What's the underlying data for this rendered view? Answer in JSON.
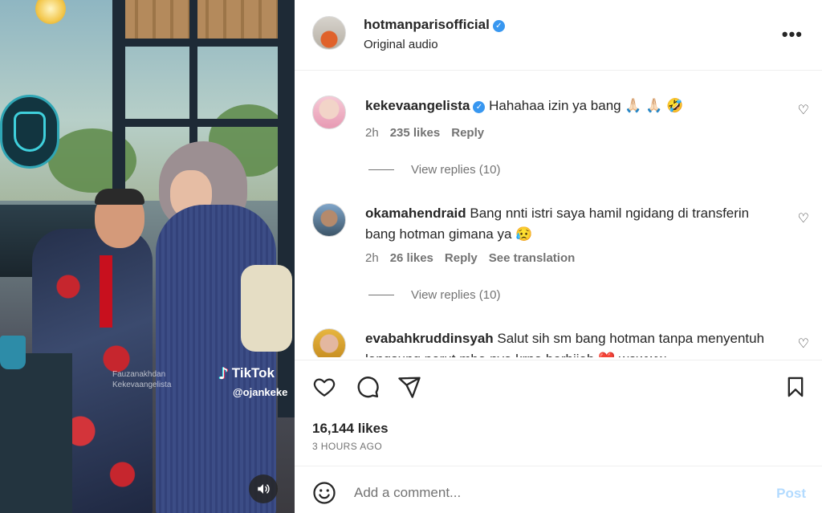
{
  "post": {
    "username": "hotmanparisofficial",
    "audio": "Original audio",
    "verified": true,
    "likes": "16,144 likes",
    "time": "3 HOURS AGO"
  },
  "media": {
    "watermark_line1": "Fauzanakhdan",
    "watermark_line2": "Kekevaangelista",
    "tiktok_label": "TikTok",
    "tiktok_handle": "@ojankeke"
  },
  "comments": [
    {
      "username": "kekevaangelista",
      "verified": true,
      "text": "Hahahaa izin ya bang 🙏🏻 🙏🏻 🤣",
      "age": "2h",
      "likes": "235 likes",
      "reply": "Reply",
      "view_replies": "View replies (10)"
    },
    {
      "username": "okamahendraid",
      "verified": false,
      "text": "Bang nnti istri saya hamil ngidang di transferin bang hotman gimana ya 😥",
      "age": "2h",
      "likes": "26 likes",
      "reply": "Reply",
      "translation": "See translation",
      "view_replies": "View replies (10)"
    },
    {
      "username": "evabahkruddinsyah",
      "verified": false,
      "text": "Salut sih sm bang hotman tanpa menyentuh langsung perut mba nya krna berhijab ❤️ wowww"
    }
  ],
  "composer": {
    "placeholder": "Add a comment...",
    "post_label": "Post"
  },
  "colors": {
    "verified": "#3897f0",
    "post_disabled": "#b3dbff",
    "secondary_text": "#737373"
  },
  "icons": [
    "more-icon",
    "heart-icon",
    "comment-icon",
    "share-icon",
    "save-icon",
    "emoji-icon",
    "volume-icon"
  ]
}
